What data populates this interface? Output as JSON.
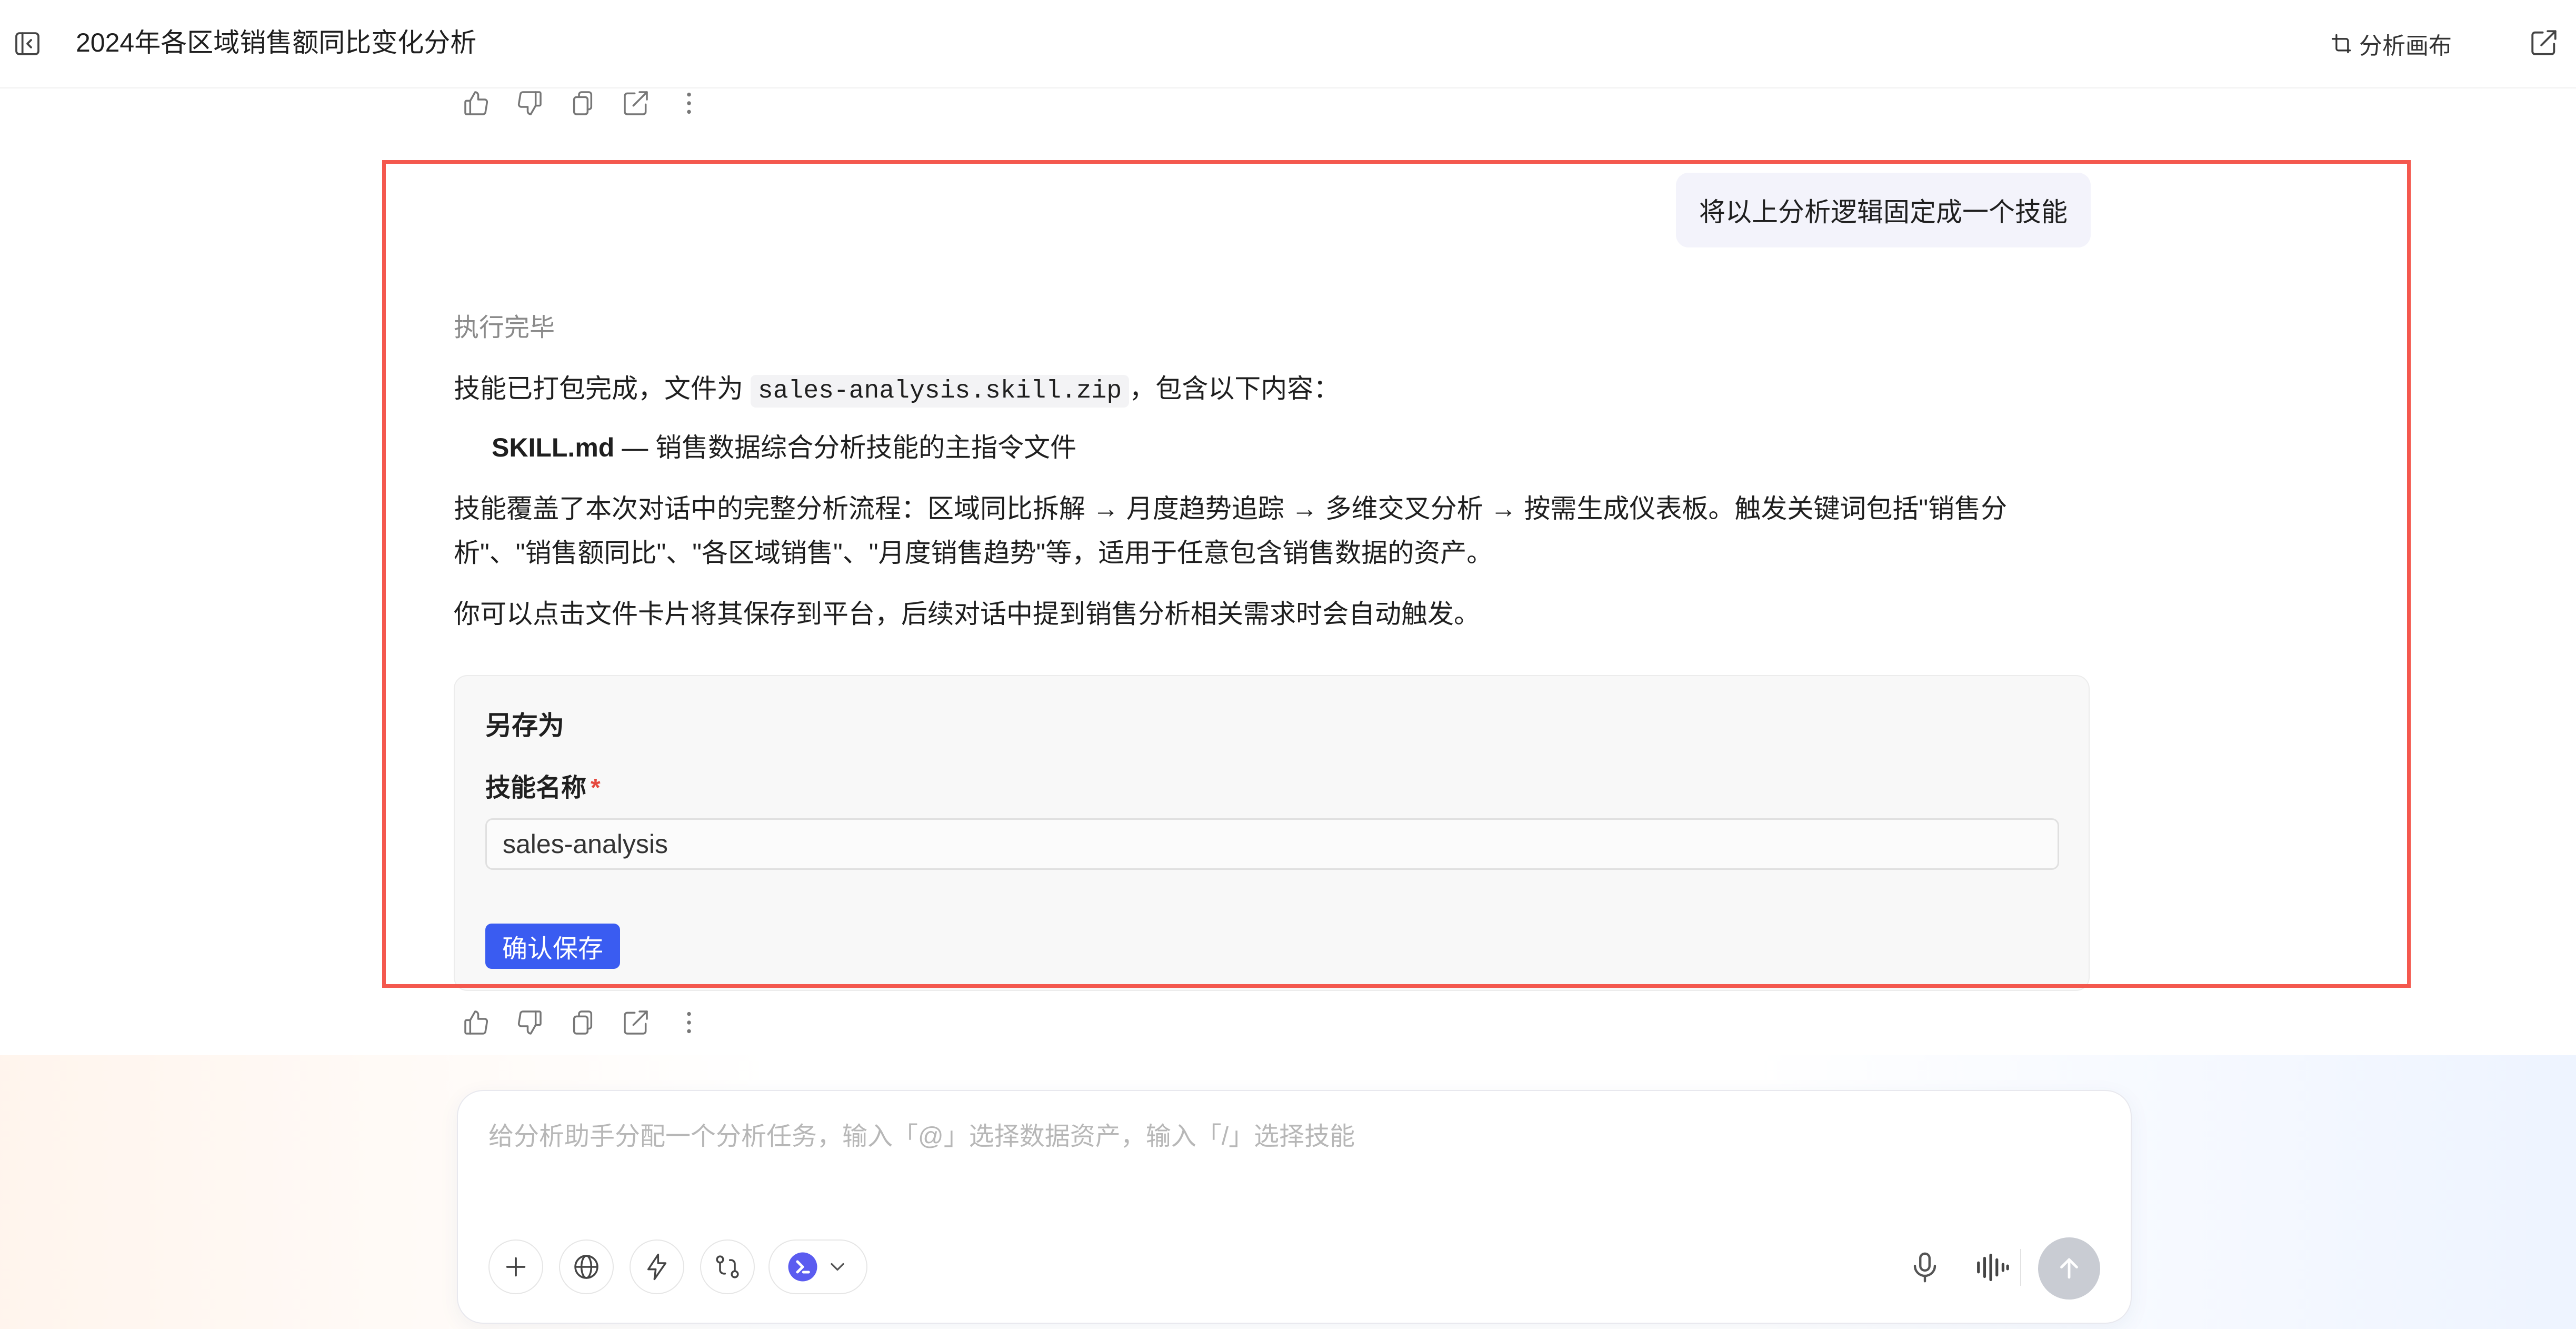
{
  "header": {
    "title": "2024年各区域销售额同比变化分析",
    "canvas_label": "分析画布"
  },
  "conversation": {
    "user_message": "将以上分析逻辑固定成一个技能",
    "status": "执行完毕",
    "packaged_prefix": "技能已打包完成，文件为",
    "file_name": "sales-analysis.skill.zip",
    "packaged_suffix": "，包含以下内容：",
    "bullet_file": "SKILL.md",
    "bullet_desc": " — 销售数据综合分析技能的主指令文件",
    "coverage_line1": "技能覆盖了本次对话中的完整分析流程：区域同比拆解 → 月度趋势追踪 → 多维交叉分析 → 按需生成仪表板。触发关键词包括\"销售分",
    "coverage_line2": "析\"、\"销售额同比\"、\"各区域销售\"、\"月度销售趋势\"等，适用于任意包含销售数据的资产。",
    "save_hint": "你可以点击文件卡片将其保存到平台，后续对话中提到销售分析相关需求时会自动触发。"
  },
  "save_form": {
    "title": "另存为",
    "name_label": "技能名称",
    "required_mark": "*",
    "name_value": "sales-analysis",
    "confirm_label": "确认保存"
  },
  "composer": {
    "placeholder": "给分析助手分配一个分析任务，输入「@」选择数据资产，输入「/」选择技能"
  },
  "colors": {
    "accent": "#3a5cf1",
    "highlight_border": "#f4584e",
    "required": "#e5483d"
  },
  "icons": [
    "sidebar-toggle-icon",
    "canvas-icon",
    "export-icon",
    "thumbs-up-icon",
    "thumbs-down-icon",
    "copy-icon",
    "share-icon",
    "more-icon",
    "plus-icon",
    "globe-icon",
    "lightning-icon",
    "workflow-icon",
    "model-icon",
    "chevron-down-icon",
    "microphone-icon",
    "voice-wave-icon",
    "send-arrow-icon"
  ]
}
